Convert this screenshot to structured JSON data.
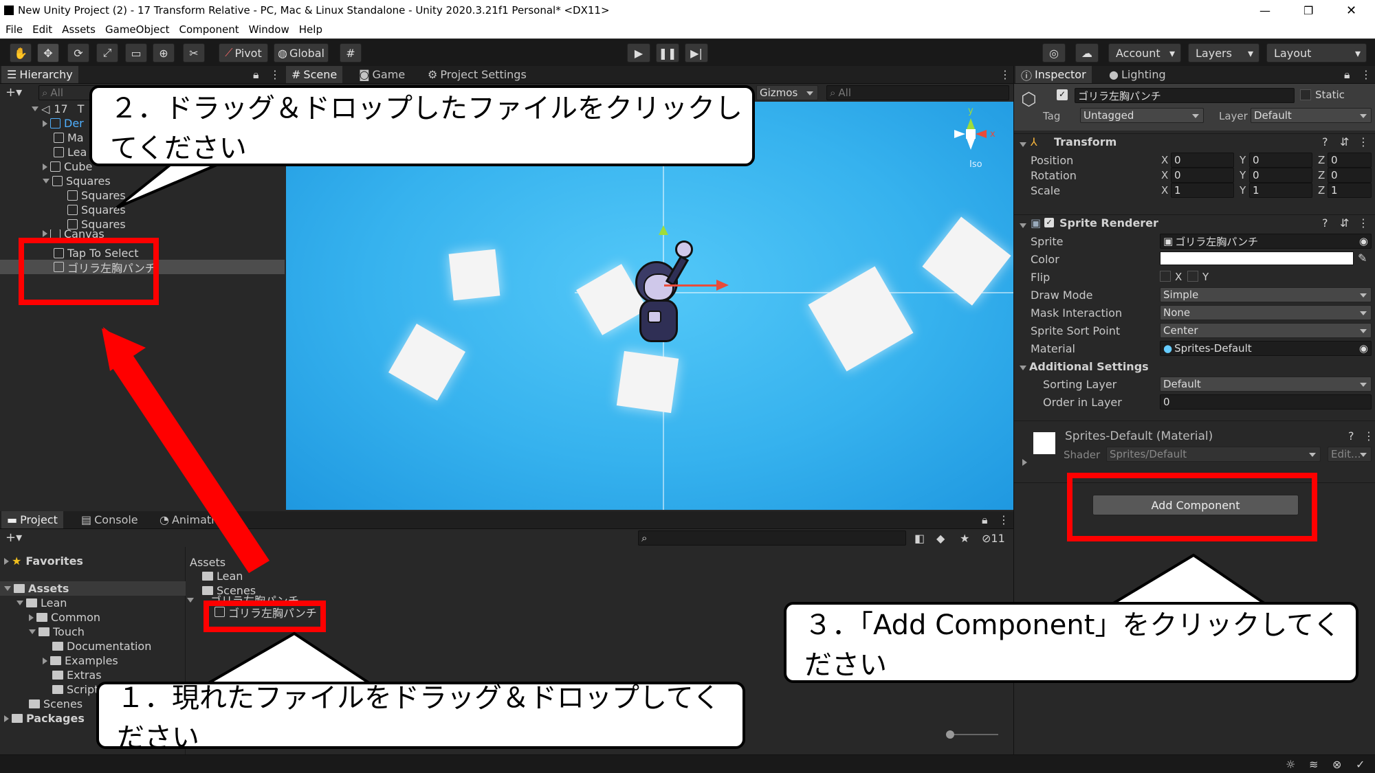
{
  "window": {
    "title": "New Unity Project (2) - 17    Transform Relative - PC, Mac & Linux Standalone - Unity 2020.3.21f1 Personal* <DX11>",
    "controls": [
      "—",
      "❐",
      "✕"
    ]
  },
  "menu": [
    "File",
    "Edit",
    "Assets",
    "GameObject",
    "Component",
    "Window",
    "Help"
  ],
  "toolbar": {
    "pivot": "Pivot",
    "global": "Global",
    "account": "Account",
    "layers": "Layers",
    "layout": "Layout"
  },
  "hierarchy": {
    "tab": "Hierarchy",
    "search_placeholder": "All",
    "scene_name": "17",
    "scene_suffix": "T",
    "items": [
      "Der",
      "Ma",
      "Lea",
      "Cube",
      "Squares",
      "Squares",
      "Squares",
      "Squares",
      "Canvas",
      "Tap To Select",
      "ゴリラ左胸パンチ"
    ]
  },
  "scene": {
    "tabs": [
      "Scene",
      "Game",
      "Project Settings"
    ],
    "gizmos": "Gizmos",
    "search_placeholder": "All",
    "gizmo_y": "y",
    "gizmo_x": "x",
    "iso": "Iso"
  },
  "project": {
    "tabs": [
      "Project",
      "Console",
      "Animation"
    ],
    "count": "11",
    "favorites": "Favorites",
    "tree": [
      "Assets",
      "Lean",
      "Common",
      "Touch",
      "Documentation",
      "Examples",
      "Extras",
      "Scripts",
      "Scenes",
      "Packages"
    ],
    "assets_header": "Assets",
    "assets_list": [
      "Lean",
      "Scenes",
      "ゴリラ左胸パンチ",
      "ゴリラ左胸パンチ"
    ]
  },
  "inspector": {
    "tabs": [
      "Inspector",
      "Lighting"
    ],
    "object_name": "ゴリラ左胸パンチ",
    "static": "Static",
    "tag_label": "Tag",
    "tag_value": "Untagged",
    "layer_label": "Layer",
    "layer_value": "Default",
    "transform": {
      "title": "Transform",
      "position": {
        "label": "Position",
        "x": "0",
        "y": "0",
        "z": "0"
      },
      "rotation": {
        "label": "Rotation",
        "x": "0",
        "y": "0",
        "z": "0"
      },
      "scale": {
        "label": "Scale",
        "x": "1",
        "y": "1",
        "z": "1"
      }
    },
    "sprite_renderer": {
      "title": "Sprite Renderer",
      "sprite_label": "Sprite",
      "sprite_value": "ゴリラ左胸パンチ",
      "color_label": "Color",
      "flip_label": "Flip",
      "flip_x": "X",
      "flip_y": "Y",
      "draw_mode_label": "Draw Mode",
      "draw_mode_value": "Simple",
      "mask_label": "Mask Interaction",
      "mask_value": "None",
      "sort_point_label": "Sprite Sort Point",
      "sort_point_value": "Center",
      "material_label": "Material",
      "material_value": "Sprites-Default",
      "additional": "Additional Settings",
      "sorting_layer_label": "Sorting Layer",
      "sorting_layer_value": "Default",
      "order_label": "Order in Layer",
      "order_value": "0"
    },
    "material": {
      "title": "Sprites-Default (Material)",
      "shader_label": "Shader",
      "shader_value": "Sprites/Default",
      "edit": "Edit..."
    },
    "add_component": "Add Component"
  },
  "callouts": {
    "step1": "１．現れたファイルをドラッグ＆ドロップしてください",
    "step2": "２．ドラッグ＆ドロップしたファイルをクリックしてください",
    "step3": "３．「Add Component」をクリックしてください"
  },
  "colors": {
    "annotation_red": "#ff0000",
    "scene_sky": "#3ab6f0",
    "editor_dark": "#282828"
  }
}
